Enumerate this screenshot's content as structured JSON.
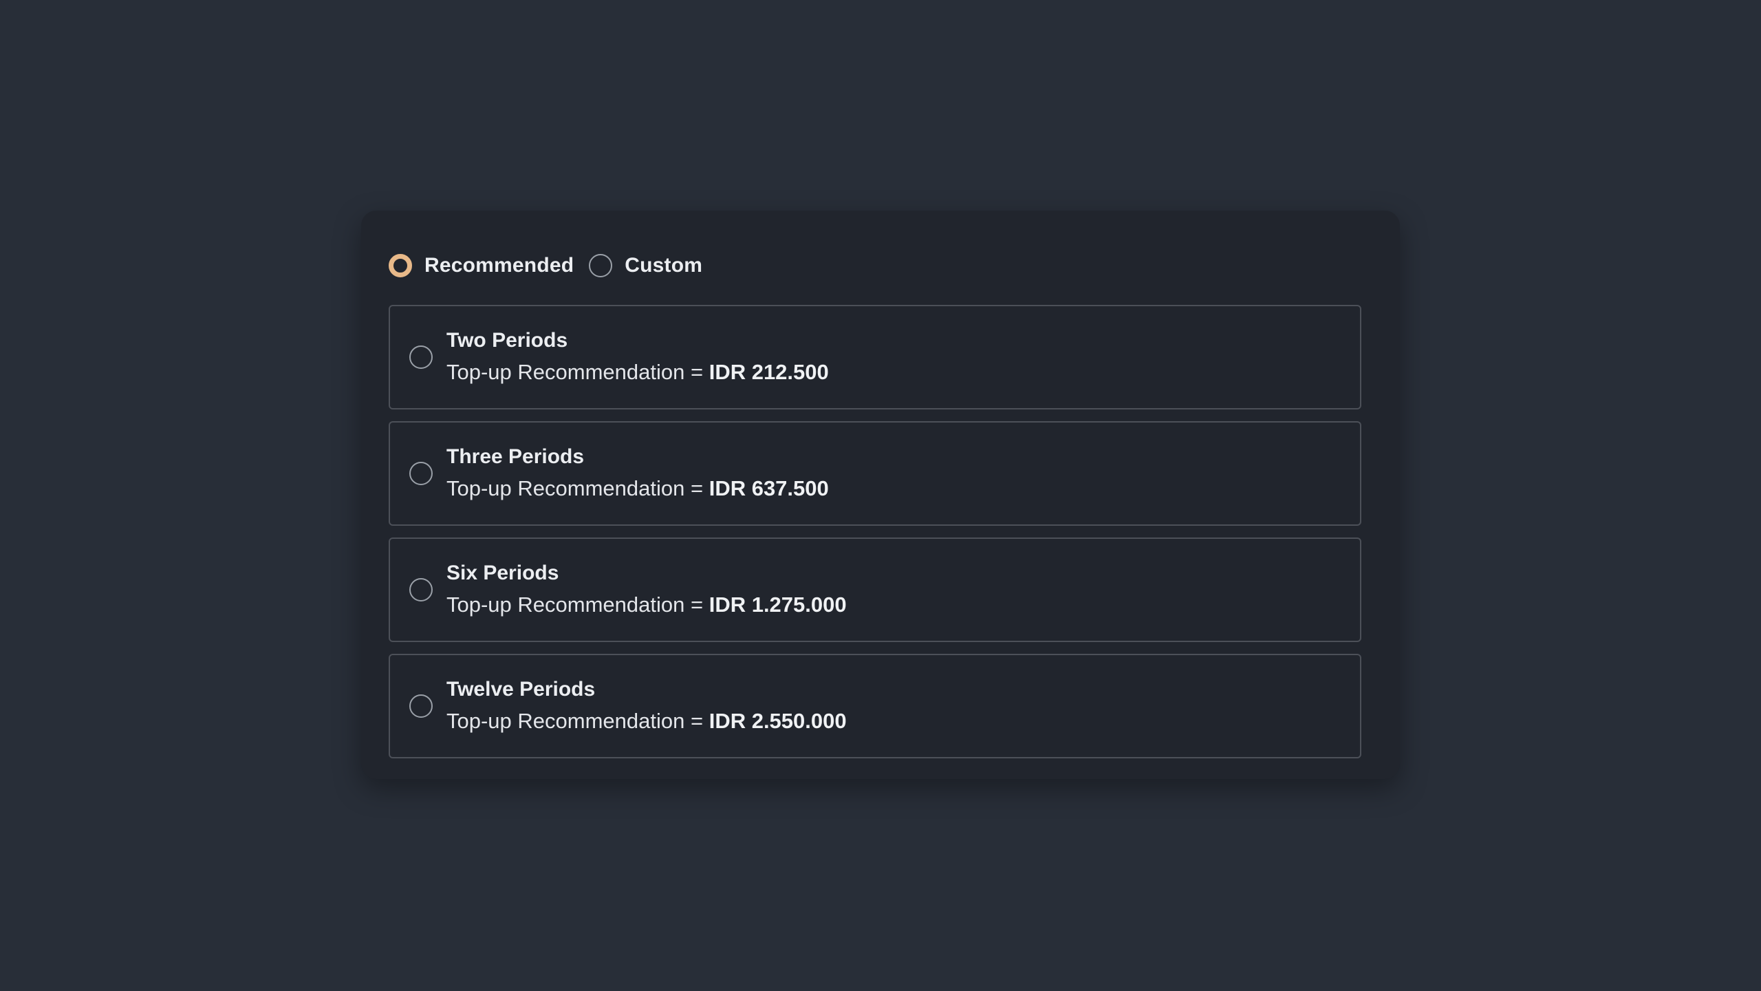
{
  "mode": {
    "options": [
      {
        "label": "Recommended",
        "selected": true
      },
      {
        "label": "Custom",
        "selected": false
      }
    ]
  },
  "plans": [
    {
      "title": "Two Periods",
      "description": "Top-up Recommendation =",
      "amount": "IDR 212.500",
      "selected": false
    },
    {
      "title": "Three Periods",
      "description": "Top-up Recommendation =",
      "amount": "IDR 637.500",
      "selected": false
    },
    {
      "title": "Six Periods",
      "description": "Top-up Recommendation =",
      "amount": "IDR 1.275.000",
      "selected": false
    },
    {
      "title": "Twelve Periods",
      "description": "Top-up Recommendation =",
      "amount": "IDR 2.550.000",
      "selected": false
    }
  ],
  "colors": {
    "background": "#282e38",
    "card": "#21252d",
    "accent": "#e8b989",
    "border": "#4c5058"
  }
}
